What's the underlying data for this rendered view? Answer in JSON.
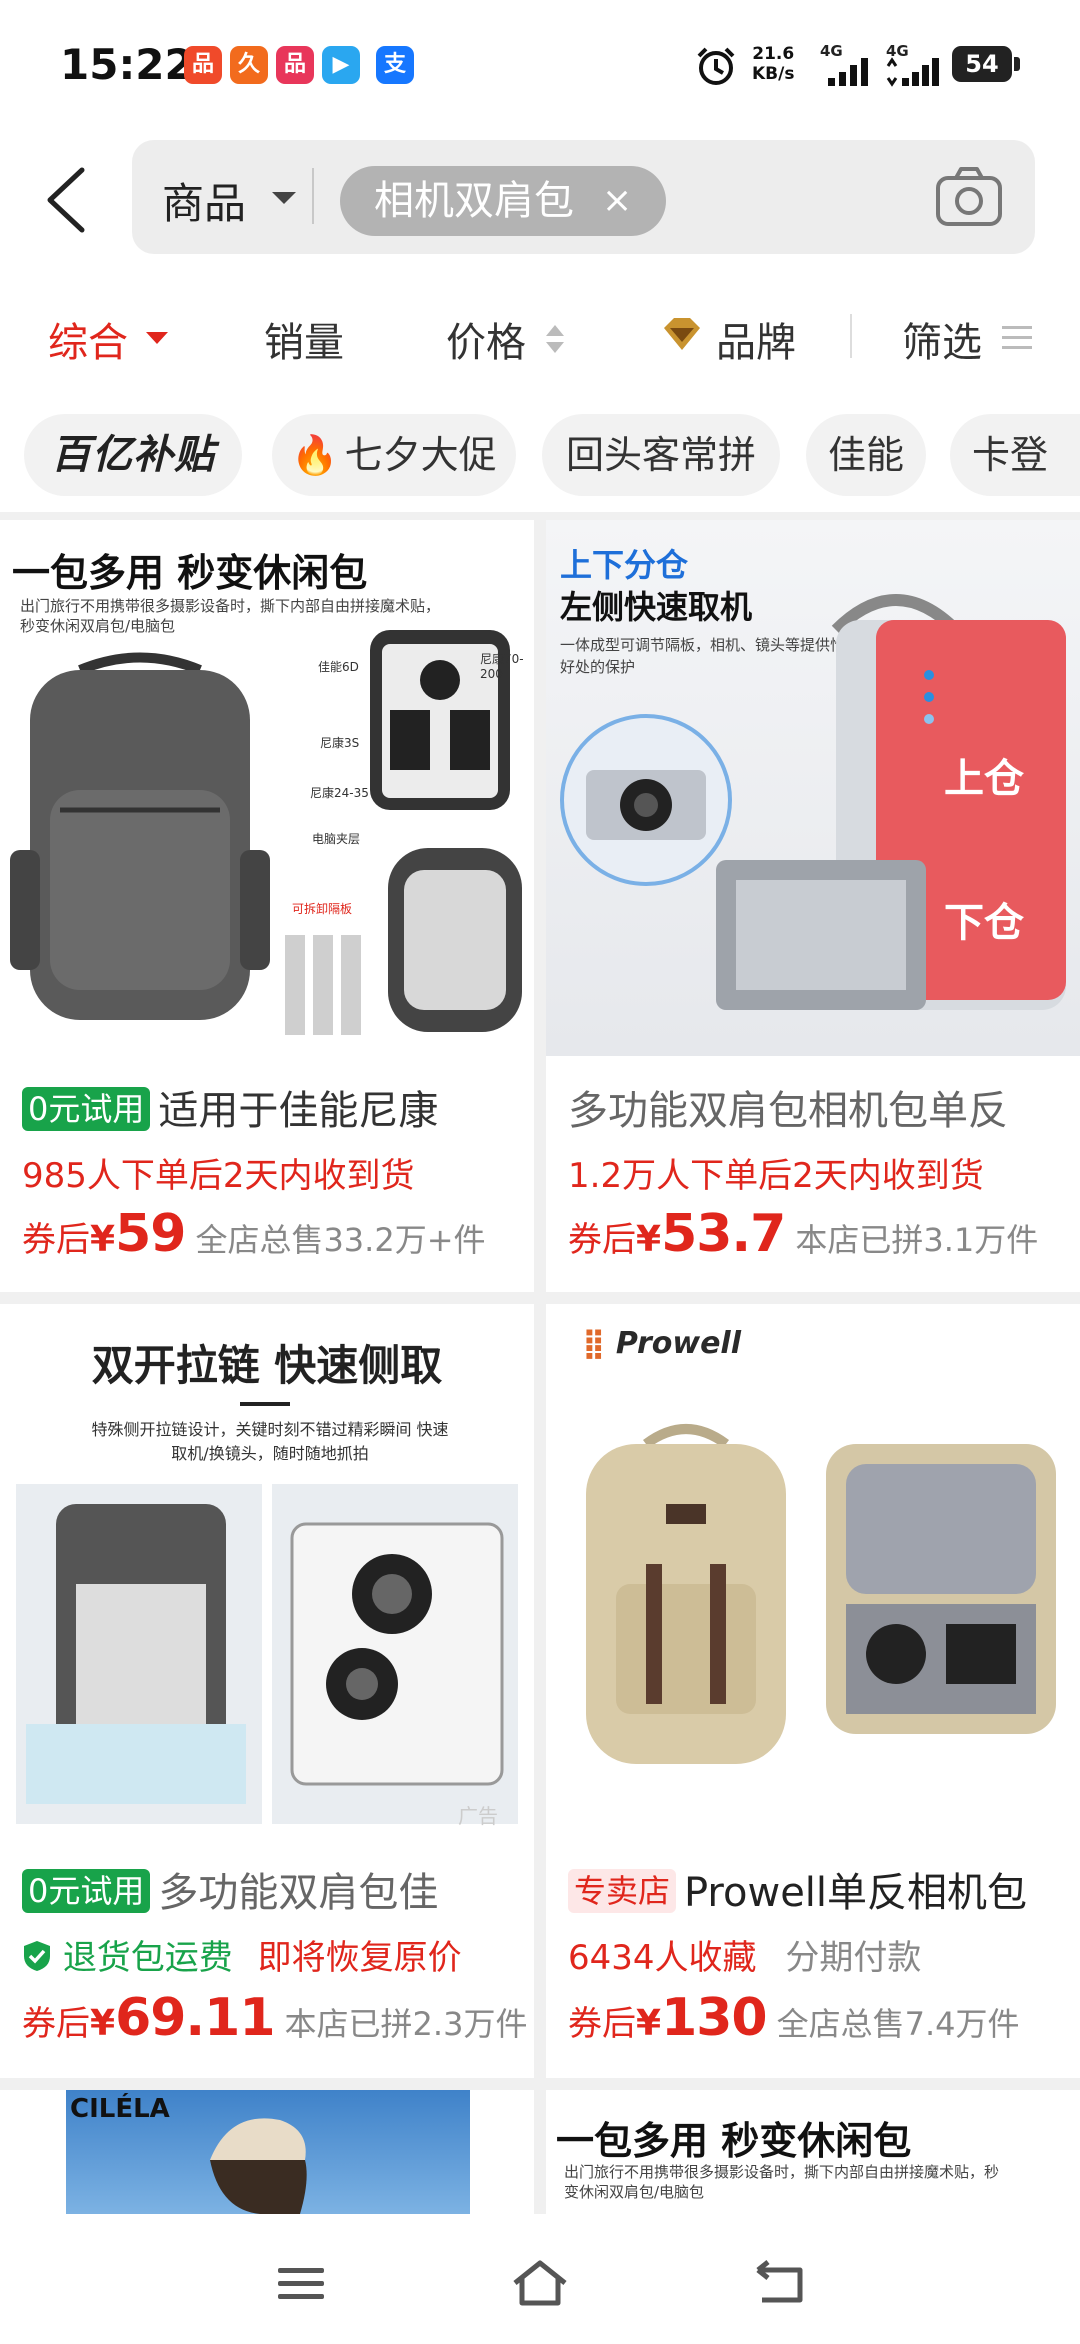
{
  "status": {
    "time": "15:22",
    "speed_value": "21.6",
    "speed_unit": "KB/s",
    "net1": "4G",
    "net2": "4G",
    "battery": "54",
    "app_icons": [
      {
        "name": "app-red-icon",
        "glyph": "品",
        "color": "#f04a2a"
      },
      {
        "name": "app-orange-icon",
        "glyph": "久",
        "color": "#f26b1d"
      },
      {
        "name": "app-pink-icon",
        "glyph": "品",
        "color": "#e8365a"
      },
      {
        "name": "app-video-icon",
        "glyph": "▶",
        "color": "#2aa7f0"
      },
      {
        "name": "app-alipay-icon",
        "glyph": "支",
        "color": "#1677ff"
      }
    ]
  },
  "search": {
    "scope": "商品",
    "keyword": "相机双肩包",
    "clear": "×"
  },
  "sort_tabs": {
    "general": "综合",
    "sales": "销量",
    "price": "价格",
    "brand": "品牌",
    "filter": "筛选"
  },
  "quick_tags": [
    "百亿补贴",
    "七夕大促",
    "回头客常拼",
    "佳能",
    "卡登"
  ],
  "products": [
    {
      "img_headline": "一包多用 秒变休闲包",
      "img_caption": "出门旅行不用携带很多摄影设备时，撕下内部自由拼接魔术贴，秒变休闲双肩包/电脑包",
      "img_labels": [
        "佳能6D",
        "尼康70-200",
        "尼康3S",
        "尼康24-35",
        "电脑夹层",
        "可拆卸隔板"
      ],
      "badge": "0元试用",
      "title": "适用于佳能尼康",
      "sub": "985人下单后2天内收到货",
      "price_prefix": "券后",
      "yen": "¥",
      "price": "59",
      "sold": "全店总售33.2万+件"
    },
    {
      "img_headline": "上下分仓",
      "img_headline2": "左侧快速取机",
      "img_caption": "一体成型可调节隔板，相机、镜头等提供恰到好处的保护",
      "img_upper": "上仓",
      "img_lower": "下仓",
      "title": "多功能双肩包相机包单反",
      "sub": "1.2万人下单后2天内收到货",
      "price_prefix": "券后",
      "yen": "¥",
      "price": "53.7",
      "sold": "本店已拼3.1万件"
    },
    {
      "img_headline": "双开拉链 快速侧取",
      "img_caption": "特殊侧开拉链设计，关键时刻不错过精彩瞬间 快速取机/换镜头，随时随地抓拍",
      "ad_tag": "广告",
      "badge": "0元试用",
      "title": "多功能双肩包佳",
      "sub_icon_label": "退货包运费",
      "sub_extra": "即将恢复原价",
      "price_prefix": "券后",
      "yen": "¥",
      "price": "69.11",
      "sold": "本店已拼2.3万件"
    },
    {
      "img_brand": "Prowell",
      "badge": "专卖店",
      "title": "Prowell单反相机包",
      "sub": "6434人收藏",
      "sub_extra": "分期付款",
      "price_prefix": "券后",
      "yen": "¥",
      "price": "130",
      "sold": "全店总售7.4万件"
    },
    {
      "img_brand": "CILÉLA"
    },
    {
      "img_headline": "一包多用 秒变休闲包",
      "img_caption": "出门旅行不用携带很多摄影设备时，撕下内部自由拼接魔术贴，秒变休闲双肩包/电脑包"
    }
  ],
  "colors": {
    "accent_red": "#e0261c",
    "badge_green": "#18a34a",
    "brand_gold": "#c9932f"
  }
}
